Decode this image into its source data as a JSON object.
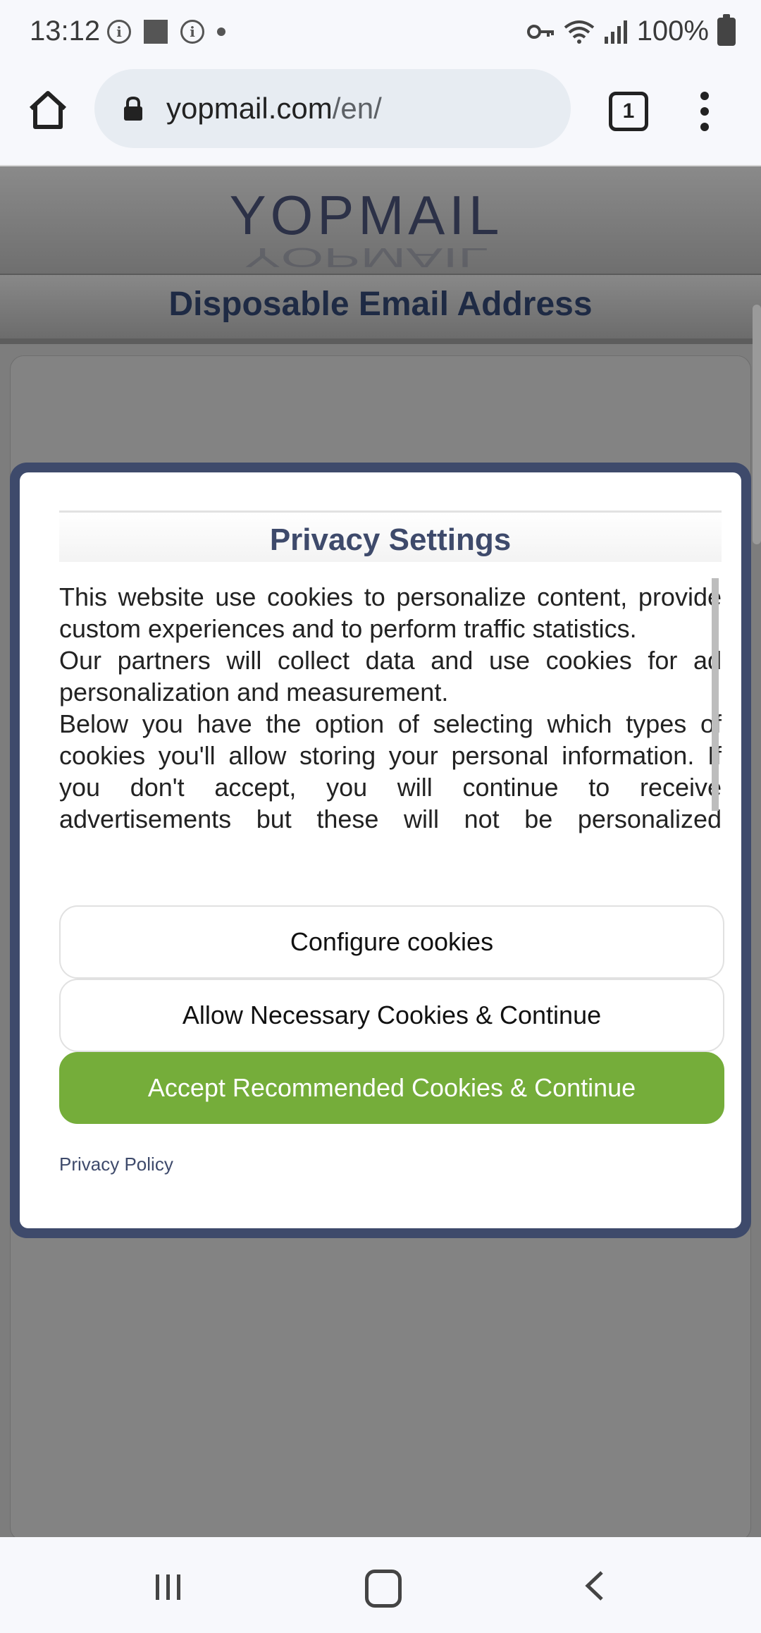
{
  "status_bar": {
    "time": "13:12",
    "battery": "100%",
    "icons": [
      "info-icon",
      "square-icon",
      "info-icon",
      "dot-icon",
      "vpn-key-icon",
      "wifi-icon",
      "signal-icon",
      "battery-charging-icon"
    ]
  },
  "browser": {
    "url_host": "yopmail.com",
    "url_path": "/en/",
    "tab_count": "1"
  },
  "page": {
    "logo_text": "YOPMAIL",
    "subtitle": "Disposable Email Address"
  },
  "modal": {
    "title": "Privacy Settings",
    "paragraphs": [
      "This website use cookies to personalize content, provide custom experiences and to perform traffic statistics.",
      "Our partners will collect data and use cookies for ad personalization and measurement.",
      "Below you have the option of selecting which types of cookies you'll allow storing your personal information. If you don't accept, you will continue to receive advertisements but these will not be personalized according to your interests. You can modify your choices at any time by using the \"cookies\" link at the"
    ],
    "configure_label": "Configure cookies",
    "necessary_label": "Allow Necessary Cookies & Continue",
    "accept_label": "Accept Recommended Cookies & Continue",
    "policy_link": "Privacy Policy"
  },
  "colors": {
    "accent_green": "#75ad3a",
    "modal_border": "#3e4a6b",
    "title_color": "#3e4a6b"
  }
}
